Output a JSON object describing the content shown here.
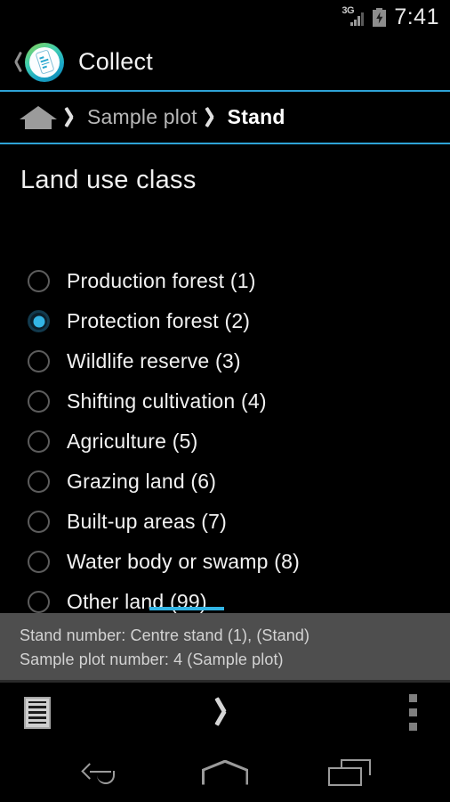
{
  "status_bar": {
    "network_label": "3G",
    "signal_icon": "signal-bars-icon",
    "battery_icon": "battery-charging-icon",
    "clock": "7:41"
  },
  "action_bar": {
    "up_icon": "back-caret-icon",
    "app_logo_icon": "collect-app-logo-icon",
    "title": "Collect"
  },
  "breadcrumb": {
    "home_icon": "home-icon",
    "separator": "chevron-right-icon",
    "items": [
      {
        "label": "Sample plot",
        "current": false
      },
      {
        "label": "Stand",
        "current": true
      }
    ],
    "accent_color": "#2ea3d6"
  },
  "main": {
    "title": "Land use class",
    "selected_value": "Protection forest (2)",
    "accent_color": "#33b5e5",
    "options": [
      {
        "label": "Production forest (1)",
        "code": "1",
        "selected": false
      },
      {
        "label": "Protection forest (2)",
        "code": "2",
        "selected": true
      },
      {
        "label": "Wildlife reserve (3)",
        "code": "3",
        "selected": false
      },
      {
        "label": "Shifting cultivation (4)",
        "code": "4",
        "selected": false
      },
      {
        "label": "Agriculture (5)",
        "code": "5",
        "selected": false
      },
      {
        "label": "Grazing land (6)",
        "code": "6",
        "selected": false
      },
      {
        "label": "Built-up areas (7)",
        "code": "7",
        "selected": false
      },
      {
        "label": "Water body or swamp (8)",
        "code": "8",
        "selected": false
      },
      {
        "label": "Other land (99)",
        "code": "99",
        "selected": false
      }
    ]
  },
  "info_panel": {
    "lines": [
      "Stand number: Centre stand (1),  (Stand)",
      "Sample plot number: 4 (Sample plot)"
    ],
    "background_color": "#4e4e4e"
  },
  "toolbar": {
    "list_icon": "list-view-icon",
    "next_icon": "chevron-right-icon",
    "overflow_icon": "overflow-menu-icon"
  },
  "nav_bar": {
    "back_icon": "navigation-back-icon",
    "home_icon": "navigation-home-icon",
    "recent_icon": "navigation-recent-apps-icon"
  }
}
